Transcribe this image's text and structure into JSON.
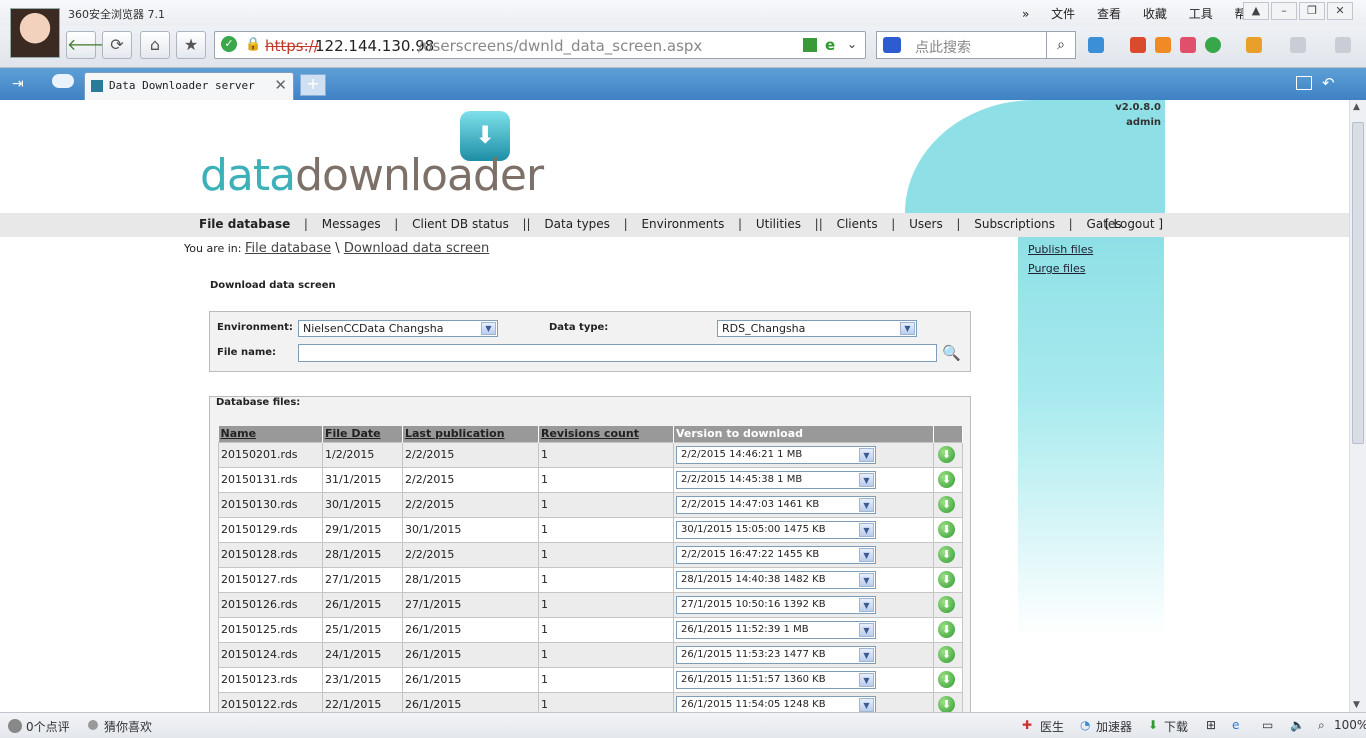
{
  "browser": {
    "title": "360安全浏览器 7.1",
    "menu": [
      "文件",
      "查看",
      "收藏",
      "工具",
      "帮助"
    ],
    "address": {
      "scheme": "https://",
      "host": "122.144.130.98",
      "path": "/userscreens/dwnld_data_screen.aspx"
    },
    "search_placeholder": "点此搜索",
    "tab_title": "Data Downloader server",
    "status_left": [
      "0个点评",
      "猜你喜欢"
    ],
    "status_right": [
      "医生",
      "加速器",
      "下载",
      "100%"
    ]
  },
  "app": {
    "version": "v2.0.8.0",
    "user": "admin",
    "logo_part1": "data",
    "logo_part2": "downloader",
    "nav": [
      "File database",
      "Messages",
      "Client DB status",
      "Data types",
      "Environments",
      "Utilities",
      "Clients",
      "Users",
      "Subscriptions",
      "Gates"
    ],
    "logout": "[ Logout ]",
    "side_links": [
      "Publish files",
      "Purge files"
    ],
    "crumb_prefix": "You are in:",
    "crumb_1": "File database",
    "crumb_sep": " \\ ",
    "crumb_2": "Download data screen",
    "page_title": "Download data screen"
  },
  "filters": {
    "environment_label": "Environment:",
    "environment_value": "NielsenCCData Changsha",
    "datatype_label": "Data type:",
    "datatype_value": "RDS_Changsha",
    "filename_label": "File name:",
    "filename_value": ""
  },
  "files": {
    "title": "Database files:",
    "columns": [
      "Name",
      "File Date",
      "Last publication",
      "Revisions count",
      "Version to download"
    ],
    "rows": [
      {
        "name": "20150201.rds",
        "file_date": "1/2/2015",
        "last_pub": "2/2/2015",
        "revisions": "1",
        "version": "2/2/2015 14:46:21 1 MB"
      },
      {
        "name": "20150131.rds",
        "file_date": "31/1/2015",
        "last_pub": "2/2/2015",
        "revisions": "1",
        "version": "2/2/2015 14:45:38 1 MB"
      },
      {
        "name": "20150130.rds",
        "file_date": "30/1/2015",
        "last_pub": "2/2/2015",
        "revisions": "1",
        "version": "2/2/2015 14:47:03 1461 KB"
      },
      {
        "name": "20150129.rds",
        "file_date": "29/1/2015",
        "last_pub": "30/1/2015",
        "revisions": "1",
        "version": "30/1/2015 15:05:00 1475 KB"
      },
      {
        "name": "20150128.rds",
        "file_date": "28/1/2015",
        "last_pub": "2/2/2015",
        "revisions": "1",
        "version": "2/2/2015 16:47:22 1455 KB"
      },
      {
        "name": "20150127.rds",
        "file_date": "27/1/2015",
        "last_pub": "28/1/2015",
        "revisions": "1",
        "version": "28/1/2015 14:40:38 1482 KB"
      },
      {
        "name": "20150126.rds",
        "file_date": "26/1/2015",
        "last_pub": "27/1/2015",
        "revisions": "1",
        "version": "27/1/2015 10:50:16 1392 KB"
      },
      {
        "name": "20150125.rds",
        "file_date": "25/1/2015",
        "last_pub": "26/1/2015",
        "revisions": "1",
        "version": "26/1/2015 11:52:39 1 MB"
      },
      {
        "name": "20150124.rds",
        "file_date": "24/1/2015",
        "last_pub": "26/1/2015",
        "revisions": "1",
        "version": "26/1/2015 11:53:23 1477 KB"
      },
      {
        "name": "20150123.rds",
        "file_date": "23/1/2015",
        "last_pub": "26/1/2015",
        "revisions": "1",
        "version": "26/1/2015 11:51:57 1360 KB"
      },
      {
        "name": "20150122.rds",
        "file_date": "22/1/2015",
        "last_pub": "26/1/2015",
        "revisions": "1",
        "version": "26/1/2015 11:54:05 1248 KB"
      }
    ]
  }
}
